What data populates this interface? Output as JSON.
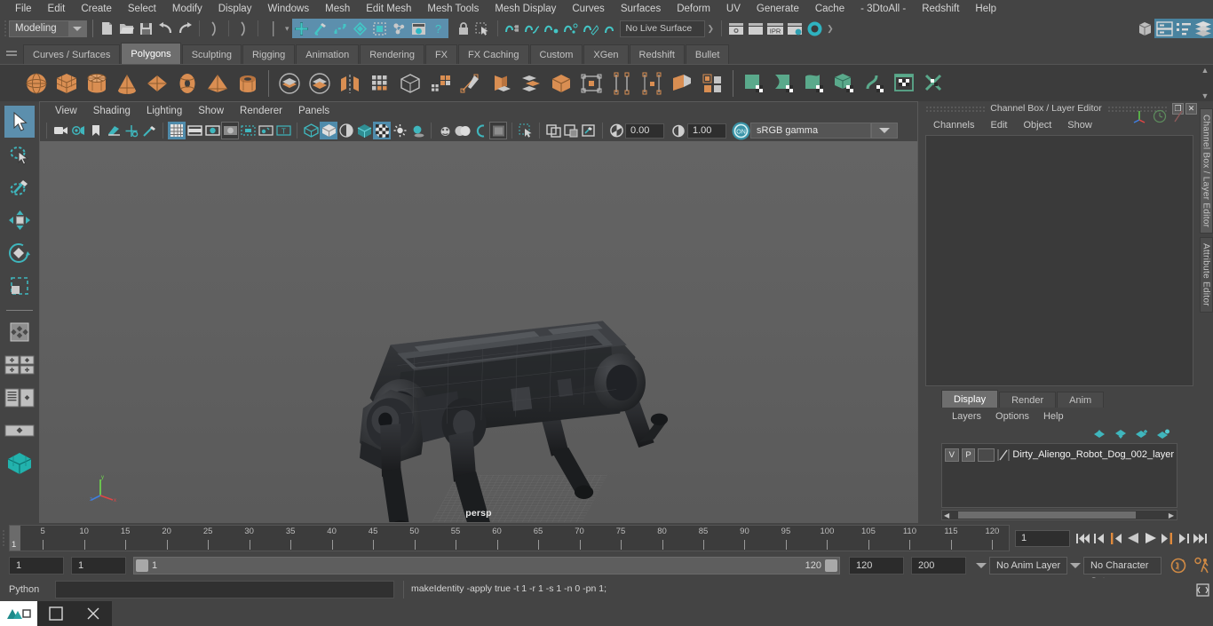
{
  "menubar": {
    "items": [
      "File",
      "Edit",
      "Create",
      "Select",
      "Modify",
      "Display",
      "Windows",
      "Mesh",
      "Edit Mesh",
      "Mesh Tools",
      "Mesh Display",
      "Curves",
      "Surfaces",
      "Deform",
      "UV",
      "Generate",
      "Cache",
      "- 3DtoAll -",
      "Redshift",
      "Help"
    ]
  },
  "statusline": {
    "mode": "Modeling",
    "live_surface": "No Live Surface",
    "icons": [
      "new-scene-icon",
      "open-scene-icon",
      "save-scene-icon",
      "undo-icon",
      "redo-icon",
      "select-by-hierarchy-icon",
      "select-by-object-icon",
      "select-by-component-icon",
      "select-tool-icon",
      "paint-select-icon",
      "lasso-select-icon",
      "soft-select-icon",
      "symmetry-icon",
      "marking-menu-icon",
      "help-icon",
      "lock-selection-icon",
      "highlight-selection-icon",
      "snap-to-grid-icon",
      "snap-to-curve-icon",
      "snap-to-point-icon",
      "snap-to-projected-center-icon",
      "snap-to-view-plane-icon",
      "make-live-icon",
      "render-view-icon",
      "render-current-frame-icon",
      "ipr-render-icon",
      "render-settings-icon",
      "hypershade-icon",
      "open-render-view-icon",
      "show-hide-editors-icon",
      "outliner-icon",
      "node-editor-icon",
      "attribute-editor-icon",
      "channel-box-layer-editor-icon"
    ]
  },
  "shelf": {
    "tabs": [
      "Curves / Surfaces",
      "Polygons",
      "Sculpting",
      "Rigging",
      "Animation",
      "Rendering",
      "FX",
      "FX Caching",
      "Custom",
      "XGen",
      "Redshift",
      "Bullet"
    ],
    "active_tab": "Polygons",
    "icons": [
      "poly-sphere-icon",
      "poly-cube-icon",
      "poly-cylinder-icon",
      "poly-cone-icon",
      "poly-plane-icon",
      "poly-torus-icon",
      "poly-pyramid-icon",
      "poly-pipe-icon",
      "poly-boolean-union-icon",
      "poly-boolean-difference-icon",
      "poly-combine-icon",
      "poly-smooth-icon",
      "poly-extract-icon",
      "poly-quadrangulate-icon",
      "poly-create-tool-icon",
      "poly-extrude-icon",
      "poly-bevel-icon",
      "poly-bridge-icon",
      "poly-append-icon",
      "poly-multicut-icon",
      "poly-target-weld-icon",
      "poly-wedge-icon",
      "poly-connect-icon",
      "uv-plane-icon",
      "uv-cylinder-icon",
      "uv-sphere-icon",
      "uv-automatic-icon",
      "uv-unfold-icon",
      "uv-editor-icon",
      "uv-cut-sew-icon"
    ]
  },
  "toolbox": {
    "tools": [
      "select-tool-icon",
      "lasso-select-tool-icon",
      "paint-select-tool-icon",
      "move-tool-icon",
      "rotate-tool-icon",
      "scale-tool-icon",
      "last-tool-icon",
      "single-pane-layout-icon",
      "two-pane-layout-icon",
      "four-pane-layout-icon",
      "outliner-persp-layout-icon",
      "persp-graph-layout-icon",
      "hypershade-layout-icon"
    ],
    "selected": "select-tool-icon"
  },
  "viewport": {
    "menu": [
      "View",
      "Shading",
      "Lighting",
      "Show",
      "Renderer",
      "Panels"
    ],
    "camera_label": "persp",
    "exposure": "0.00",
    "gamma": "1.00",
    "color_space": "sRGB gamma",
    "toolbar_icons": [
      "select-camera-icon",
      "camera-attributes-icon",
      "bookmark-icon",
      "image-plane-icon",
      "2d-pan-zoom-icon",
      "grease-pencil-icon",
      "grid-icon",
      "film-gate-icon",
      "resolution-gate-icon",
      "gate-mask-icon",
      "field-chart-icon",
      "safe-action-icon",
      "safe-title-icon",
      "wireframe-icon",
      "smooth-shade-icon",
      "shaded-wireframe-icon",
      "hardware-texturing-icon",
      "use-all-lights-icon",
      "shadows-icon",
      "screen-space-ao-icon",
      "motion-blur-icon",
      "multisample-aa-icon",
      "depth-of-field-icon",
      "isolate-select-icon",
      "xray-icon",
      "xray-joints-icon",
      "xray-active-components-icon",
      "exposure-icon",
      "gamma-icon",
      "color-management-on-icon"
    ]
  },
  "channelbox": {
    "title": "Channel Box / Layer Editor",
    "menu": [
      "Channels",
      "Edit",
      "Object",
      "Show"
    ],
    "header_icons": [
      "axis-gizmo-icon",
      "clock-icon",
      "slash-icon"
    ],
    "window_buttons": [
      "undock-icon",
      "close-icon"
    ]
  },
  "layereditor": {
    "tabs": [
      "Display",
      "Render",
      "Anim"
    ],
    "active_tab": "Display",
    "menu": [
      "Layers",
      "Options",
      "Help"
    ],
    "buttons": [
      "move-layer-up-icon",
      "move-layer-down-icon",
      "new-layer-icon",
      "new-layer-from-selected-icon"
    ],
    "layers": [
      {
        "visibility": "V",
        "playback": "P",
        "shading": "",
        "name": "Dirty_Aliengo_Robot_Dog_002_layer"
      }
    ]
  },
  "rightdock": {
    "vertical_tabs": [
      "Channel Box / Layer Editor",
      "Attribute Editor"
    ]
  },
  "timeslider": {
    "ticks": [
      5,
      10,
      15,
      20,
      25,
      30,
      35,
      40,
      45,
      50,
      55,
      60,
      65,
      70,
      75,
      80,
      85,
      90,
      95,
      100,
      105,
      110,
      115,
      120
    ],
    "current_frame": "1",
    "frame_field": "1",
    "playback_buttons": [
      "go-to-start-icon",
      "step-back-frame-icon",
      "step-back-key-icon",
      "play-backwards-icon",
      "play-forwards-icon",
      "step-forward-key-icon",
      "step-forward-frame-icon",
      "go-to-end-icon"
    ]
  },
  "rangeslider": {
    "anim_start": "1",
    "range_start": "1",
    "bar_start": "1",
    "bar_end": "120",
    "range_end": "120",
    "anim_end": "200",
    "anim_layer": "No Anim Layer",
    "character_set": "No Character Set",
    "right_icons": [
      "auto-keyframe-icon",
      "animation-preferences-icon"
    ]
  },
  "commandline": {
    "language": "Python",
    "input_value": "",
    "result": "makeIdentity -apply true -t 1 -r 1 -s 1 -n 0 -pn 1;",
    "script_editor_icon": "script-editor-icon"
  },
  "taskbar": {
    "items": [
      "maya-app-icon",
      "task-view-icon",
      "close-window-icon"
    ]
  },
  "colors": {
    "accent_blue": "#5c8fad",
    "shelf_orange": "#d98e52",
    "shelf_green": "#5aa98b",
    "teal": "#3fb6bd",
    "window_bg": "#444444",
    "panel_bg": "#3a3a3a"
  }
}
